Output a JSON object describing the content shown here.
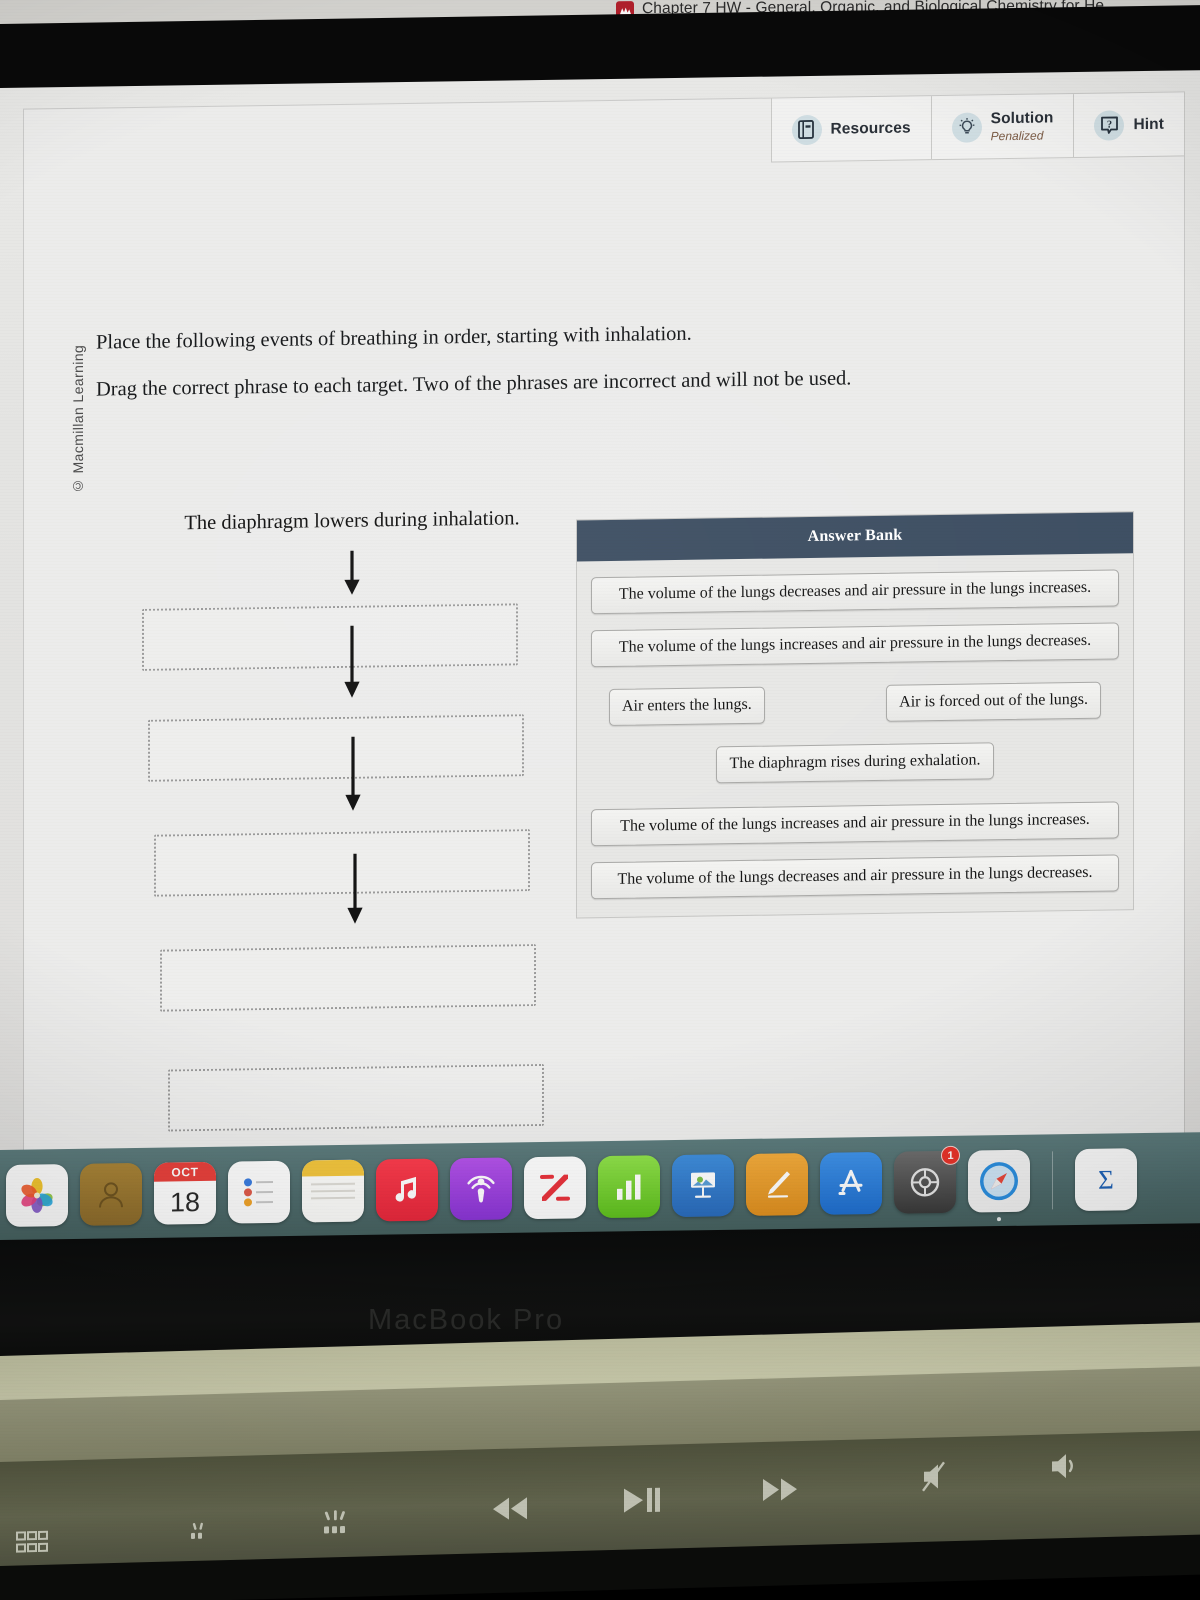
{
  "browser": {
    "tab_title": "Chapter 7 HW - General, Organic, and Biological Chemistry for He",
    "favicon_name": "macmillan-icon"
  },
  "toolbar": {
    "resources_label": "Resources",
    "solution_label": "Solution",
    "solution_sub": "Penalized",
    "hint_label": "Hint"
  },
  "copyright": "© Macmillan Learning",
  "prompt": {
    "line1": "Place the following events of breathing in order, starting with inhalation.",
    "line2": "Drag the correct phrase to each target. Two of the phrases are incorrect and will not be used."
  },
  "flow": {
    "first_step": "The diaphragm lowers during inhalation.",
    "slots": [
      "",
      "",
      "",
      "",
      ""
    ]
  },
  "answer_bank": {
    "title": "Answer Bank",
    "chips": [
      "The volume of the lungs decreases and air pressure in the lungs increases.",
      "The volume of the lungs increases and air pressure in the lungs decreases.",
      "Air enters the lungs.",
      "Air is forced out of the lungs.",
      "The diaphragm rises during exhalation.",
      "The volume of the lungs increases and air pressure in the lungs increases.",
      "The volume of the lungs decreases and air pressure in the lungs decreases."
    ]
  },
  "scroll_button": {
    "name": "scroll-down-button"
  },
  "dock": {
    "items": [
      {
        "name": "photos-icon",
        "label": "Photos"
      },
      {
        "name": "contacts-icon",
        "label": "Contacts"
      },
      {
        "name": "calendar-icon",
        "label": "Calendar",
        "month": "OCT",
        "day": "18"
      },
      {
        "name": "reminders-icon",
        "label": "Reminders"
      },
      {
        "name": "notes-icon",
        "label": "Notes"
      },
      {
        "name": "music-icon",
        "label": "Music"
      },
      {
        "name": "podcasts-icon",
        "label": "Podcasts"
      },
      {
        "name": "news-icon",
        "label": "News"
      },
      {
        "name": "numbers-icon",
        "label": "Numbers"
      },
      {
        "name": "keynote-icon",
        "label": "Keynote"
      },
      {
        "name": "pages-icon",
        "label": "Pages"
      },
      {
        "name": "app-store-icon",
        "label": "App Store"
      },
      {
        "name": "system-preferences-icon",
        "label": "System Preferences",
        "badge": "1"
      },
      {
        "name": "safari-icon",
        "label": "Safari"
      },
      {
        "name": "mathtype-icon",
        "label": "MathType"
      }
    ]
  },
  "laptop": {
    "model_label": "MacBook Pro"
  },
  "function_keys": [
    {
      "name": "launchpad-key"
    },
    {
      "name": "keyboard-brightness-down-key"
    },
    {
      "name": "keyboard-brightness-up-key"
    },
    {
      "name": "rewind-key"
    },
    {
      "name": "play-pause-key"
    },
    {
      "name": "fast-forward-key"
    },
    {
      "name": "mute-key"
    },
    {
      "name": "volume-down-key"
    }
  ],
  "colors": {
    "answer_bank_header": "#3d4e62",
    "dock_background": "#4e6b6c",
    "scroll_button": "#31435d",
    "tool_glyph_bg": "#cfdde2",
    "penalized_text": "#7a5a44"
  }
}
